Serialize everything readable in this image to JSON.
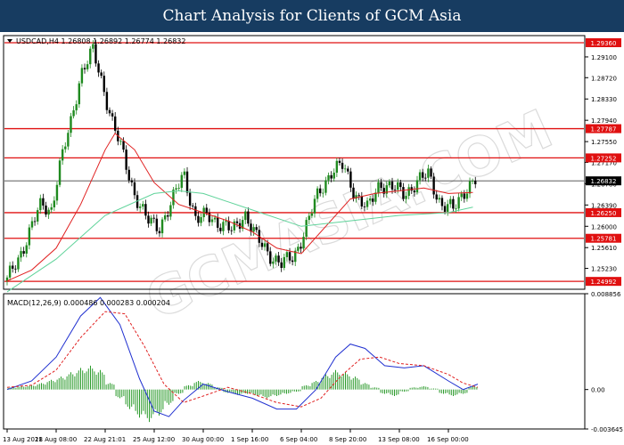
{
  "banner": {
    "title": "Chart Analysis for Clients of GCM Asia"
  },
  "header": {
    "symbol_line": "USDCAD,H4  1.26808 1.26892 1.26774 1.26832"
  },
  "watermark": {
    "text": "GCMASIA.COM"
  },
  "colors": {
    "banner_bg": "#173c61",
    "bull_candle": "#1f8a1f",
    "bear_candle": "#000000",
    "ma_fast": "#e02020",
    "ma_slow": "#5fd39a",
    "level_line": "#e01010",
    "level_label_bg": "#e01010",
    "price_label_bg": "#000000",
    "macd_line": "#2030d0",
    "signal_line": "#e02020",
    "histogram": "#2a9a2a"
  },
  "chart_data": [
    {
      "type": "candlestick",
      "title": "USDCAD,H4",
      "x": [
        "13 Aug 2021",
        "18 Aug 08:00",
        "22 Aug 21:01",
        "25 Aug 12:00",
        "30 Aug 00:00",
        "1 Sep 16:00",
        "6 Sep 04:00",
        "8 Sep 20:00",
        "13 Sep 08:00",
        "16 Sep 00:00"
      ],
      "ylim": [
        1.24848,
        1.2949
      ],
      "yticks": [
        1.2949,
        1.291,
        1.2872,
        1.2833,
        1.2794,
        1.2755,
        1.2717,
        1.2678,
        1.2639,
        1.26,
        1.2561,
        1.2523,
        1.2484
      ],
      "levels": [
        1.2936,
        1.27787,
        1.27252,
        1.2625,
        1.25781,
        1.24992
      ],
      "current_price": 1.26832,
      "close_path": [
        [
          0.0,
          1.25
        ],
        [
          0.25,
          1.2545
        ],
        [
          0.5,
          1.26
        ],
        [
          0.7,
          1.264
        ],
        [
          0.9,
          1.263
        ],
        [
          1.05,
          1.27
        ],
        [
          1.3,
          1.279
        ],
        [
          1.5,
          1.288
        ],
        [
          1.75,
          1.292
        ],
        [
          1.95,
          1.286
        ],
        [
          2.15,
          1.279
        ],
        [
          2.4,
          1.272
        ],
        [
          2.6,
          1.266
        ],
        [
          2.85,
          1.261
        ],
        [
          3.1,
          1.26
        ],
        [
          3.35,
          1.264
        ],
        [
          3.6,
          1.27
        ],
        [
          3.85,
          1.261
        ],
        [
          4.1,
          1.262
        ],
        [
          4.35,
          1.2605
        ],
        [
          4.6,
          1.259
        ],
        [
          4.85,
          1.2625
        ],
        [
          5.1,
          1.2575
        ],
        [
          5.35,
          1.255
        ],
        [
          5.6,
          1.253
        ],
        [
          5.85,
          1.2545
        ],
        [
          6.1,
          1.26
        ],
        [
          6.35,
          1.266
        ],
        [
          6.6,
          1.27
        ],
        [
          6.85,
          1.271
        ],
        [
          7.1,
          1.266
        ],
        [
          7.35,
          1.263
        ],
        [
          7.6,
          1.268
        ],
        [
          7.85,
          1.267
        ],
        [
          8.1,
          1.266
        ],
        [
          8.35,
          1.268
        ],
        [
          8.6,
          1.2695
        ],
        [
          8.85,
          1.264
        ],
        [
          9.1,
          1.263
        ],
        [
          9.35,
          1.267
        ],
        [
          9.55,
          1.2683
        ]
      ],
      "series": [
        {
          "name": "",
          "values": [
            [
              0.0,
              1.25
            ],
            [
              0.5,
              1.252
            ],
            [
              1.0,
              1.256
            ],
            [
              1.5,
              1.264
            ],
            [
              2.0,
              1.274
            ],
            [
              2.2,
              1.277
            ],
            [
              2.6,
              1.274
            ],
            [
              3.0,
              1.268
            ],
            [
              3.5,
              1.264
            ],
            [
              4.0,
              1.2625
            ],
            [
              4.5,
              1.261
            ],
            [
              5.0,
              1.259
            ],
            [
              5.5,
              1.256
            ],
            [
              6.0,
              1.255
            ],
            [
              6.5,
              1.26
            ],
            [
              7.0,
              1.265
            ],
            [
              7.5,
              1.266
            ],
            [
              8.0,
              1.2665
            ],
            [
              8.5,
              1.267
            ],
            [
              9.0,
              1.266
            ],
            [
              9.5,
              1.2662
            ]
          ]
        },
        {
          "name": "",
          "values": [
            [
              0.0,
              1.248
            ],
            [
              1.0,
              1.254
            ],
            [
              2.0,
              1.262
            ],
            [
              3.0,
              1.266
            ],
            [
              3.5,
              1.2665
            ],
            [
              4.0,
              1.266
            ],
            [
              5.0,
              1.263
            ],
            [
              6.0,
              1.26
            ],
            [
              7.0,
              1.261
            ],
            [
              8.0,
              1.262
            ],
            [
              9.0,
              1.2625
            ],
            [
              9.5,
              1.2635
            ]
          ]
        }
      ]
    },
    {
      "type": "line",
      "title": "MACD(12,26,9) 0.000486 0.000283 0.000204",
      "ylim": [
        -0.003645,
        0.008856
      ],
      "yticks": [
        0.008856,
        0.0,
        -0.003645
      ],
      "ytick_labels": [
        "0.008856",
        "0.00",
        "-0.003645"
      ],
      "series": [
        {
          "name": "",
          "values": [
            [
              0.0,
              0.0
            ],
            [
              0.5,
              0.0008
            ],
            [
              1.0,
              0.003
            ],
            [
              1.5,
              0.0068
            ],
            [
              1.9,
              0.0085
            ],
            [
              2.3,
              0.006
            ],
            [
              2.7,
              0.001
            ],
            [
              3.0,
              -0.002
            ],
            [
              3.3,
              -0.0025
            ],
            [
              3.6,
              -0.001
            ],
            [
              4.0,
              0.0005
            ],
            [
              4.5,
              -0.0002
            ],
            [
              5.0,
              -0.0008
            ],
            [
              5.5,
              -0.0018
            ],
            [
              5.9,
              -0.0018
            ],
            [
              6.3,
              0.0
            ],
            [
              6.7,
              0.003
            ],
            [
              7.0,
              0.0042
            ],
            [
              7.3,
              0.0038
            ],
            [
              7.7,
              0.0022
            ],
            [
              8.1,
              0.002
            ],
            [
              8.5,
              0.0022
            ],
            [
              9.0,
              0.0008
            ],
            [
              9.3,
              0.0
            ],
            [
              9.6,
              0.0005
            ]
          ]
        },
        {
          "name": "",
          "values": [
            [
              0.0,
              0.0002
            ],
            [
              0.5,
              0.0004
            ],
            [
              1.0,
              0.0018
            ],
            [
              1.5,
              0.0048
            ],
            [
              2.0,
              0.0072
            ],
            [
              2.4,
              0.007
            ],
            [
              2.8,
              0.004
            ],
            [
              3.2,
              0.0005
            ],
            [
              3.6,
              -0.0012
            ],
            [
              4.0,
              -0.0006
            ],
            [
              4.5,
              0.0002
            ],
            [
              5.0,
              -0.0004
            ],
            [
              5.5,
              -0.0012
            ],
            [
              6.0,
              -0.0016
            ],
            [
              6.4,
              -0.0008
            ],
            [
              6.8,
              0.0012
            ],
            [
              7.2,
              0.0028
            ],
            [
              7.6,
              0.003
            ],
            [
              8.0,
              0.0024
            ],
            [
              8.5,
              0.0022
            ],
            [
              9.0,
              0.0014
            ],
            [
              9.3,
              0.0006
            ],
            [
              9.6,
              0.0002
            ]
          ]
        }
      ],
      "histogram": [
        [
          0.1,
          0.0002
        ],
        [
          0.3,
          0.0003
        ],
        [
          0.5,
          0.0004
        ],
        [
          0.7,
          0.0006
        ],
        [
          0.9,
          0.0009
        ],
        [
          1.1,
          0.0012
        ],
        [
          1.3,
          0.0016
        ],
        [
          1.5,
          0.002
        ],
        [
          1.7,
          0.0022
        ],
        [
          1.9,
          0.0018
        ],
        [
          2.1,
          0.0006
        ],
        [
          2.3,
          -0.0008
        ],
        [
          2.5,
          -0.0018
        ],
        [
          2.7,
          -0.0026
        ],
        [
          2.9,
          -0.003
        ],
        [
          3.1,
          -0.0024
        ],
        [
          3.3,
          -0.0014
        ],
        [
          3.5,
          -0.0004
        ],
        [
          3.7,
          0.0004
        ],
        [
          3.9,
          0.0008
        ],
        [
          4.1,
          0.0006
        ],
        [
          4.3,
          0.0002
        ],
        [
          4.5,
          -0.0003
        ],
        [
          4.7,
          -0.0005
        ],
        [
          4.9,
          -0.0004
        ],
        [
          5.1,
          -0.0006
        ],
        [
          5.3,
          -0.0008
        ],
        [
          5.5,
          -0.0006
        ],
        [
          5.7,
          -0.0004
        ],
        [
          5.9,
          -0.0002
        ],
        [
          6.1,
          0.0004
        ],
        [
          6.3,
          0.0008
        ],
        [
          6.5,
          0.0014
        ],
        [
          6.7,
          0.0018
        ],
        [
          6.9,
          0.0016
        ],
        [
          7.1,
          0.0012
        ],
        [
          7.3,
          0.0006
        ],
        [
          7.5,
          0.0002
        ],
        [
          7.7,
          -0.0004
        ],
        [
          7.9,
          -0.0006
        ],
        [
          8.1,
          -0.0002
        ],
        [
          8.3,
          0.0002
        ],
        [
          8.5,
          0.0003
        ],
        [
          8.7,
          0.0001
        ],
        [
          8.9,
          -0.0004
        ],
        [
          9.1,
          -0.0006
        ],
        [
          9.3,
          -0.0004
        ],
        [
          9.5,
          0.0003
        ]
      ]
    }
  ]
}
